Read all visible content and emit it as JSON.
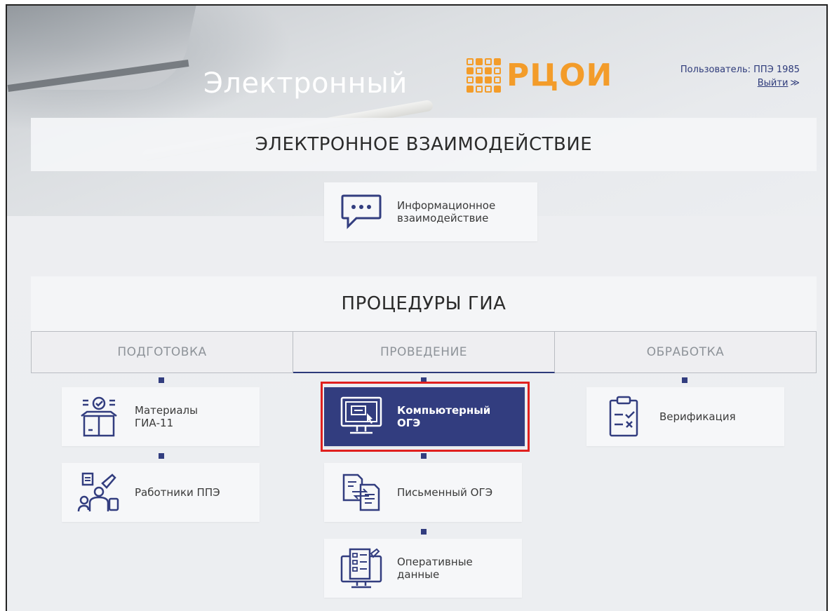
{
  "header": {
    "title": "Электронный",
    "logo_text": "РЦОИ",
    "user_label": "Пользователь: ППЭ 1985",
    "logout_label": "Выйти",
    "logout_chevron": "≫"
  },
  "sections": {
    "electronic": "ЭЛЕКТРОННОЕ ВЗАИМОДЕЙСТВИЕ",
    "gia": "ПРОЦЕДУРЫ ГИА"
  },
  "info_card": {
    "label": "Информационное\nвзаимодействие",
    "icon": "chat-bubble-icon"
  },
  "tabs": [
    {
      "label": "ПОДГОТОВКА"
    },
    {
      "label": "ПРОВЕДЕНИЕ",
      "active": true
    },
    {
      "label": "ОБРАБОТКА"
    }
  ],
  "columns": {
    "prep": [
      {
        "label": "Материалы\nГИА-11",
        "icon": "package-check-icon"
      },
      {
        "label": "Работники ППЭ",
        "icon": "workers-icon"
      }
    ],
    "conduct": [
      {
        "label": "Компьютерный\nОГЭ",
        "icon": "computer-monitor-icon",
        "selected": true
      },
      {
        "label": "Письменный ОГЭ",
        "icon": "document-exchange-icon"
      },
      {
        "label": "Оперативные\nданные",
        "icon": "monitor-report-icon"
      }
    ],
    "process": [
      {
        "label": "Верификация",
        "icon": "checklist-icon"
      }
    ]
  },
  "colors": {
    "accent": "#323d7f",
    "logo": "#f39c2a",
    "highlight": "#e0201e"
  }
}
